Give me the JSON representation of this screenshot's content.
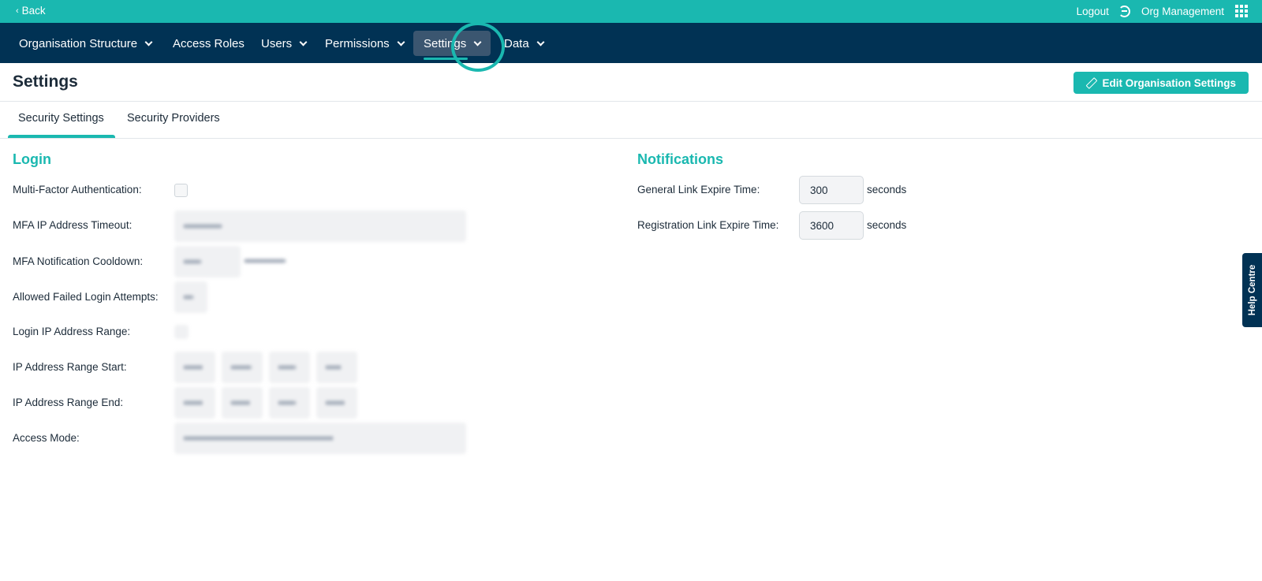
{
  "topbar": {
    "back_chevron": "‹",
    "back_label": "Back",
    "logout_label": "Logout",
    "org_label": "Org Management"
  },
  "nav": {
    "items": [
      {
        "label": "Organisation Structure",
        "has_dropdown": true
      },
      {
        "label": "Access Roles",
        "has_dropdown": false
      },
      {
        "label": "Users",
        "has_dropdown": true
      },
      {
        "label": "Permissions",
        "has_dropdown": true
      },
      {
        "label": "Settings",
        "has_dropdown": true,
        "active": true
      },
      {
        "label": "Data",
        "has_dropdown": true
      }
    ]
  },
  "page": {
    "title": "Settings",
    "edit_button_label": "Edit Organisation Settings"
  },
  "tabs": {
    "security_settings": "Security Settings",
    "security_providers": "Security Providers",
    "active": "Security Settings"
  },
  "login": {
    "title": "Login",
    "labels": {
      "mfa": "Multi-Factor Authentication:",
      "mfa_ip_timeout": "MFA IP Address Timeout:",
      "mfa_cooldown": "MFA Notification Cooldown:",
      "failed_attempts": "Allowed Failed Login Attempts:",
      "ip_range": "Login IP Address Range:",
      "ip_start": "IP Address Range Start:",
      "ip_end": "IP Address Range End:",
      "access_mode": "Access Mode:"
    },
    "mfa_checked": false
  },
  "notifications": {
    "title": "Notifications",
    "general_label": "General Link Expire Time:",
    "general_value": "300",
    "registration_label": "Registration Link Expire Time:",
    "registration_value": "3600",
    "unit": "seconds"
  },
  "help": {
    "label": "Help Centre"
  },
  "colors": {
    "accent": "#1ab8b0",
    "navy": "#013254",
    "active_nav": "#3b5670"
  }
}
